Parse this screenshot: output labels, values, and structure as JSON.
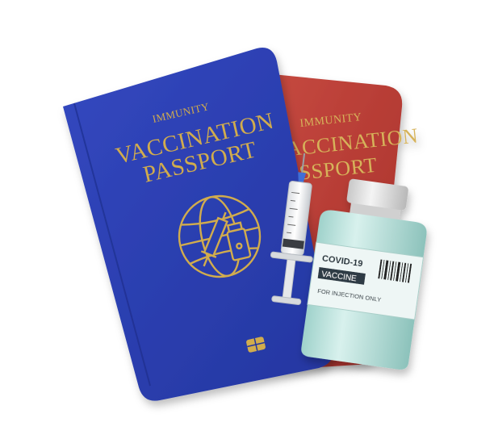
{
  "red_passport": {
    "immunity_partial": "IMMUNITY",
    "title_line1_partial": "VACCINATION",
    "title_line2_partial": "PASSPORT"
  },
  "blue_passport": {
    "immunity": "IMMUNITY",
    "title_line1": "VACCINATION",
    "title_line2": "PASSPORT"
  },
  "vial_label": {
    "line1": "COVID-19",
    "line2": "VACCINE",
    "line3": "FOR INJECTION ONLY"
  },
  "colors": {
    "blue_cover": "#2b3fb0",
    "red_cover": "#b83a32",
    "gold": "#c9a54a",
    "vial_glass": "#bfe6e0",
    "vial_cap": "#e6e6e6"
  }
}
